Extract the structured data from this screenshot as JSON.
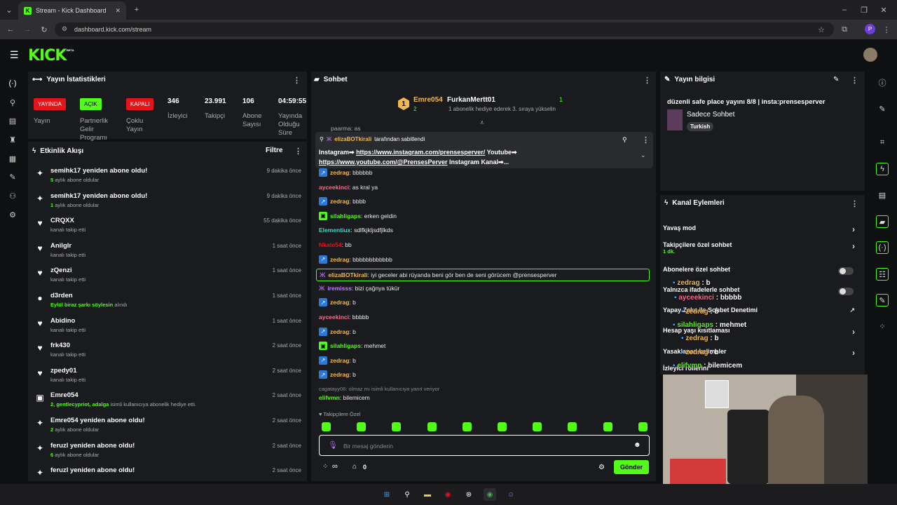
{
  "browser": {
    "tab_title": "Stream - Kick Dashboard",
    "tab_icon": "K",
    "url": "dashboard.kick.com/stream",
    "profile_initial": "P"
  },
  "app": {
    "logo": "KICK",
    "beta": "BETA"
  },
  "stats": {
    "title": "Yayın İstatistikleri",
    "badges": [
      {
        "text": "YAYINDA",
        "label": "Yayın",
        "color": "#e5141b"
      },
      {
        "text": "AÇIK",
        "label": "Partnerlik Gelir Programı",
        "color": "#53fc18"
      },
      {
        "text": "KAPALI",
        "label": "Çoklu Yayın",
        "color": "#e5141b"
      }
    ],
    "values": [
      {
        "value": "346",
        "label": "İzleyici"
      },
      {
        "value": "23.991",
        "label": "Takipçi"
      },
      {
        "value": "106",
        "label": "Abone Sayısı"
      },
      {
        "value": "04:59:55",
        "label": "Yayında Olduğu Süre"
      }
    ]
  },
  "activity": {
    "title": "Etkinlik Akışı",
    "filter": "Filtre",
    "items": [
      {
        "icon": "✦",
        "title": "semihk17 yeniden abone oldu!",
        "sub_em": "5",
        "sub": " aylık abone oldular",
        "time": "9 dakika önce"
      },
      {
        "icon": "✦",
        "title": "semihk17 yeniden abone oldu!",
        "sub_em": "1",
        "sub": " aylık abone oldular",
        "time": "9 dakika önce"
      },
      {
        "icon": "♥",
        "title": "CRQXX",
        "sub_em": "",
        "sub": "kanalı takip etti",
        "time": "55 dakika önce"
      },
      {
        "icon": "♥",
        "title": "Anilglr",
        "sub_em": "",
        "sub": "kanalı takip etti",
        "time": "1 saat önce"
      },
      {
        "icon": "♥",
        "title": "zQenzi",
        "sub_em": "",
        "sub": "kanalı takip etti",
        "time": "1 saat önce"
      },
      {
        "icon": "●",
        "title": "d3rden",
        "sub_em": "Eylül biraz şarkı söylesin",
        "sub": " alındı",
        "time": "1 saat önce"
      },
      {
        "icon": "♥",
        "title": "Abidino",
        "sub_em": "",
        "sub": "kanalı takip etti",
        "time": "1 saat önce"
      },
      {
        "icon": "♥",
        "title": "frk430",
        "sub_em": "",
        "sub": "kanalı takip etti",
        "time": "2 saat önce"
      },
      {
        "icon": "♥",
        "title": "zpedy01",
        "sub_em": "",
        "sub": "kanalı takip etti",
        "time": "2 saat önce"
      },
      {
        "icon": "▣",
        "title": "Emre054",
        "sub_em": "2, gentlecypriot, adalga",
        "sub": " isimli kullanıcıya abonelik hediye etti.",
        "time": "2 saat önce"
      },
      {
        "icon": "✦",
        "title": "Emre054 yeniden abone oldu!",
        "sub_em": "2",
        "sub": " aylık abone oldular",
        "time": "2 saat önce"
      },
      {
        "icon": "✦",
        "title": "feruzl yeniden abone oldu!",
        "sub_em": "6",
        "sub": " aylık abone oldular",
        "time": "2 saat önce"
      },
      {
        "icon": "✦",
        "title": "feruzl yeniden abone oldu!",
        "sub_em": "",
        "sub": "",
        "time": "2 saat önce"
      }
    ]
  },
  "chat": {
    "title": "Sohbet",
    "leader": {
      "rank": "1",
      "name": "Emre054",
      "count": "2",
      "name2": "FurkanMertt01",
      "count2": "1",
      "note": "1 abonelik hediye ederek 3. sıraya yükselin"
    },
    "partial_user": "paarma: as",
    "pinned": {
      "user": "elizaBOTkirali",
      "by": "tarafından sabitlendi",
      "text1": "Instagram➡ ",
      "link1": "https://www.instagram.com/prensesperver/",
      "text2": " Youtube➡",
      "link2": "https://www.youtube.com/@PrensesPerver",
      "text3": " Instagram Kanal➡..."
    },
    "messages": [
      {
        "badge": "blue",
        "user": "zedrag",
        "color": "#f2b84b",
        "text": ": bbbbbb"
      },
      {
        "badge": "",
        "user": "ayceekinci",
        "color": "#ff6b8a",
        "text": ": as kral ya"
      },
      {
        "badge": "blue",
        "user": "zedrag",
        "color": "#f2b84b",
        "text": ": bbbb"
      },
      {
        "badge": "grn",
        "user": "silahligaps",
        "color": "#53fc18",
        "text": ": erken geldin"
      },
      {
        "badge": "",
        "user": "Elementiux",
        "color": "#45d4c4",
        "text": ": sdlfkjklјsdfjlkds"
      },
      {
        "badge": "",
        "user": "Nkate54",
        "color": "#e5141b",
        "text": ": bb"
      },
      {
        "badge": "blue",
        "user": "zedrag",
        "color": "#f2b84b",
        "text": ": bbbbbbbbbbbb"
      },
      {
        "badge": "moth",
        "user": "elizaBOTkirali",
        "color": "#f2b84b",
        "text": ": iyi geceler abi rüyanda beni gör ben de seni görücem @prensesperver"
      },
      {
        "badge": "moth",
        "user": "iremisss",
        "color": "#c77dff",
        "text": ": bizi çağnya tükür"
      },
      {
        "badge": "blue",
        "user": "zedrag",
        "color": "#f2b84b",
        "text": ": b"
      },
      {
        "badge": "",
        "user": "ayceekinci",
        "color": "#ff6b8a",
        "text": ": bbbbb"
      },
      {
        "badge": "blue",
        "user": "zedrag",
        "color": "#f2b84b",
        "text": ": b"
      },
      {
        "badge": "grn",
        "user": "silahligaps",
        "color": "#53fc18",
        "text": ": mehmet"
      },
      {
        "badge": "blue",
        "user": "zedrag",
        "color": "#f2b84b",
        "text": ": b"
      },
      {
        "badge": "blue",
        "user": "zedrag",
        "color": "#f2b84b",
        "text": ": b"
      }
    ],
    "reply_note": "cagatayy06: olmaz mı isimli kullanıcıya yanıt veriyor",
    "last_msg": {
      "user": "elifvmn",
      "color": "#53fc18",
      "text": ": bilemicem"
    },
    "followers_only": "Takipçilere Özel",
    "input_placeholder": "Bir mesaj gönderin",
    "points": "∞",
    "store_count": "0",
    "send_label": "Gönder"
  },
  "stream_info": {
    "title": "Yayın bilgisi",
    "stream_title": "düzenli safe place yayını 8/8 | insta:prensesperver",
    "category": "Sadece Sohbet",
    "tag": "Turkish"
  },
  "channel_actions": {
    "title": "Kanal Eylemleri",
    "items": [
      {
        "label": "Yavaş mod",
        "sub": "",
        "control": "chevron"
      },
      {
        "label": "Takipçilere özel sohbet",
        "sub": "1 dk.",
        "control": "chevron"
      },
      {
        "label": "Abonelere özel sohbet",
        "sub": "",
        "control": "toggle"
      },
      {
        "label": "Yalnızca ifadelerle sohbet",
        "sub": "",
        "control": "toggle"
      },
      {
        "label": "Yapay Zeka ile Sohbet Denetimi",
        "sub": "",
        "control": "external"
      },
      {
        "label": "Hesap yaşı kısıtlaması",
        "sub": "",
        "control": "chevron"
      },
      {
        "label": "Yasaklanan kelimeler",
        "sub": "",
        "control": "chevron"
      },
      {
        "label": "İzleyici rollerini",
        "sub": "",
        "control": ""
      }
    ],
    "overlay_chat": [
      {
        "user": "zedrag",
        "text": " : b"
      },
      {
        "user": "ayceekinci",
        "text": " : bbbbb"
      },
      {
        "user": "zedrag",
        "text": " : b"
      },
      {
        "user": "silahligaps",
        "text": " : mehmet"
      },
      {
        "user": "zedrag",
        "text": " : b"
      },
      {
        "user": "zedrag",
        "text": " : b"
      },
      {
        "user": "elifvmn",
        "text": " : bilemicem"
      }
    ]
  },
  "colors": {
    "accent": "#53fc18",
    "live": "#e5141b",
    "panel": "#1a1b1e",
    "bg": "#0f1011"
  }
}
